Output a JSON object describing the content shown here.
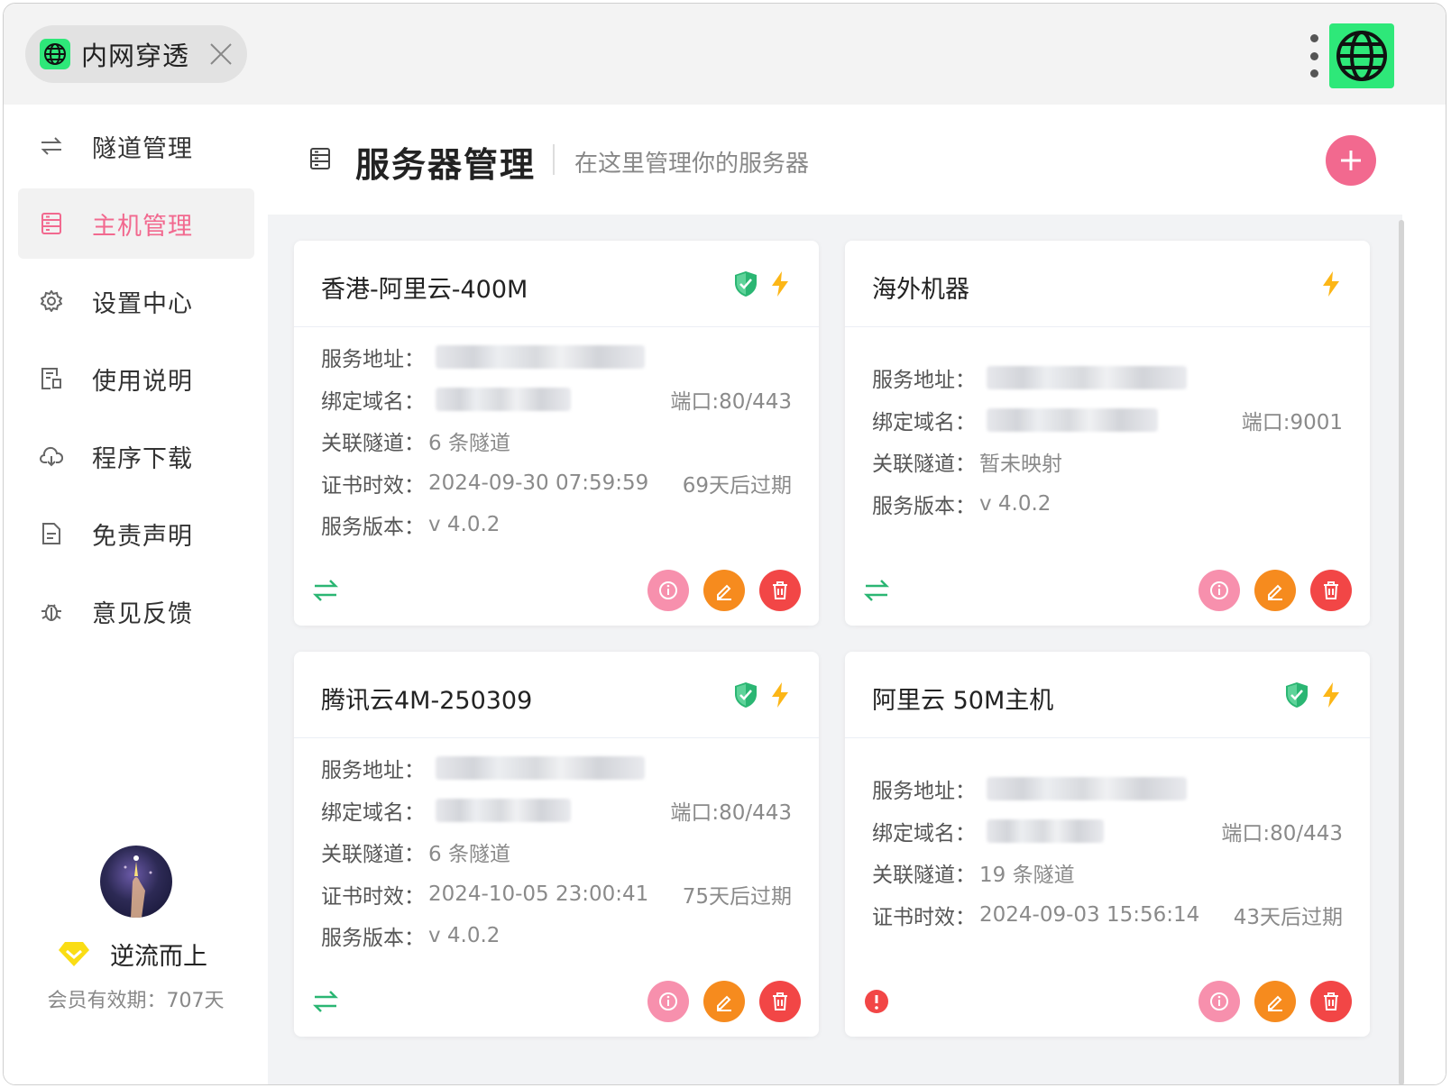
{
  "tab": {
    "title": "内网穿透",
    "icon": "globe-icon"
  },
  "sidebar": {
    "items": [
      {
        "label": "隧道管理",
        "icon": "transfer-icon",
        "active": false
      },
      {
        "label": "主机管理",
        "icon": "server-icon",
        "active": true
      },
      {
        "label": "设置中心",
        "icon": "gear-icon",
        "active": false
      },
      {
        "label": "使用说明",
        "icon": "doc-icon",
        "active": false
      },
      {
        "label": "程序下载",
        "icon": "cloud-download-icon",
        "active": false
      },
      {
        "label": "免责声明",
        "icon": "file-icon",
        "active": false
      },
      {
        "label": "意见反馈",
        "icon": "bug-icon",
        "active": false
      }
    ],
    "user": {
      "name": "逆流而上",
      "membership": "会员有效期：707天"
    }
  },
  "header": {
    "title": "服务器管理",
    "subtitle": "在这里管理你的服务器"
  },
  "labels": {
    "address": "服务地址：",
    "domain": "绑定域名：",
    "tunnels": "关联隧道：",
    "cert": "证书时效：",
    "version": "服务版本："
  },
  "cards": [
    {
      "title": "香港-阿里云-400M",
      "port": "端口:80/443",
      "tunnels": "6 条隧道",
      "cert_date": "2024-09-30 07:59:59",
      "cert_expiry": "69天后过期",
      "version": "v 4.0.2"
    },
    {
      "title": "海外机器",
      "port": "端口:9001",
      "tunnels": "暂未映射",
      "version": "v 4.0.2"
    },
    {
      "title": "腾讯云4M-250309",
      "port": "端口:80/443",
      "tunnels": "6 条隧道",
      "cert_date": "2024-10-05 23:00:41",
      "cert_expiry": "75天后过期",
      "version": "v 4.0.2"
    },
    {
      "title": "阿里云 50M主机",
      "port": "端口:80/443",
      "tunnels": "19 条隧道",
      "cert_date": "2024-09-03 15:56:14",
      "cert_expiry": "43天后过期"
    }
  ],
  "colors": {
    "accent": "#f2698f",
    "brand_green": "#2ee879",
    "edit": "#f68b1e",
    "delete": "#f24646",
    "info": "#f790ad",
    "status_green": "#2bb673"
  }
}
